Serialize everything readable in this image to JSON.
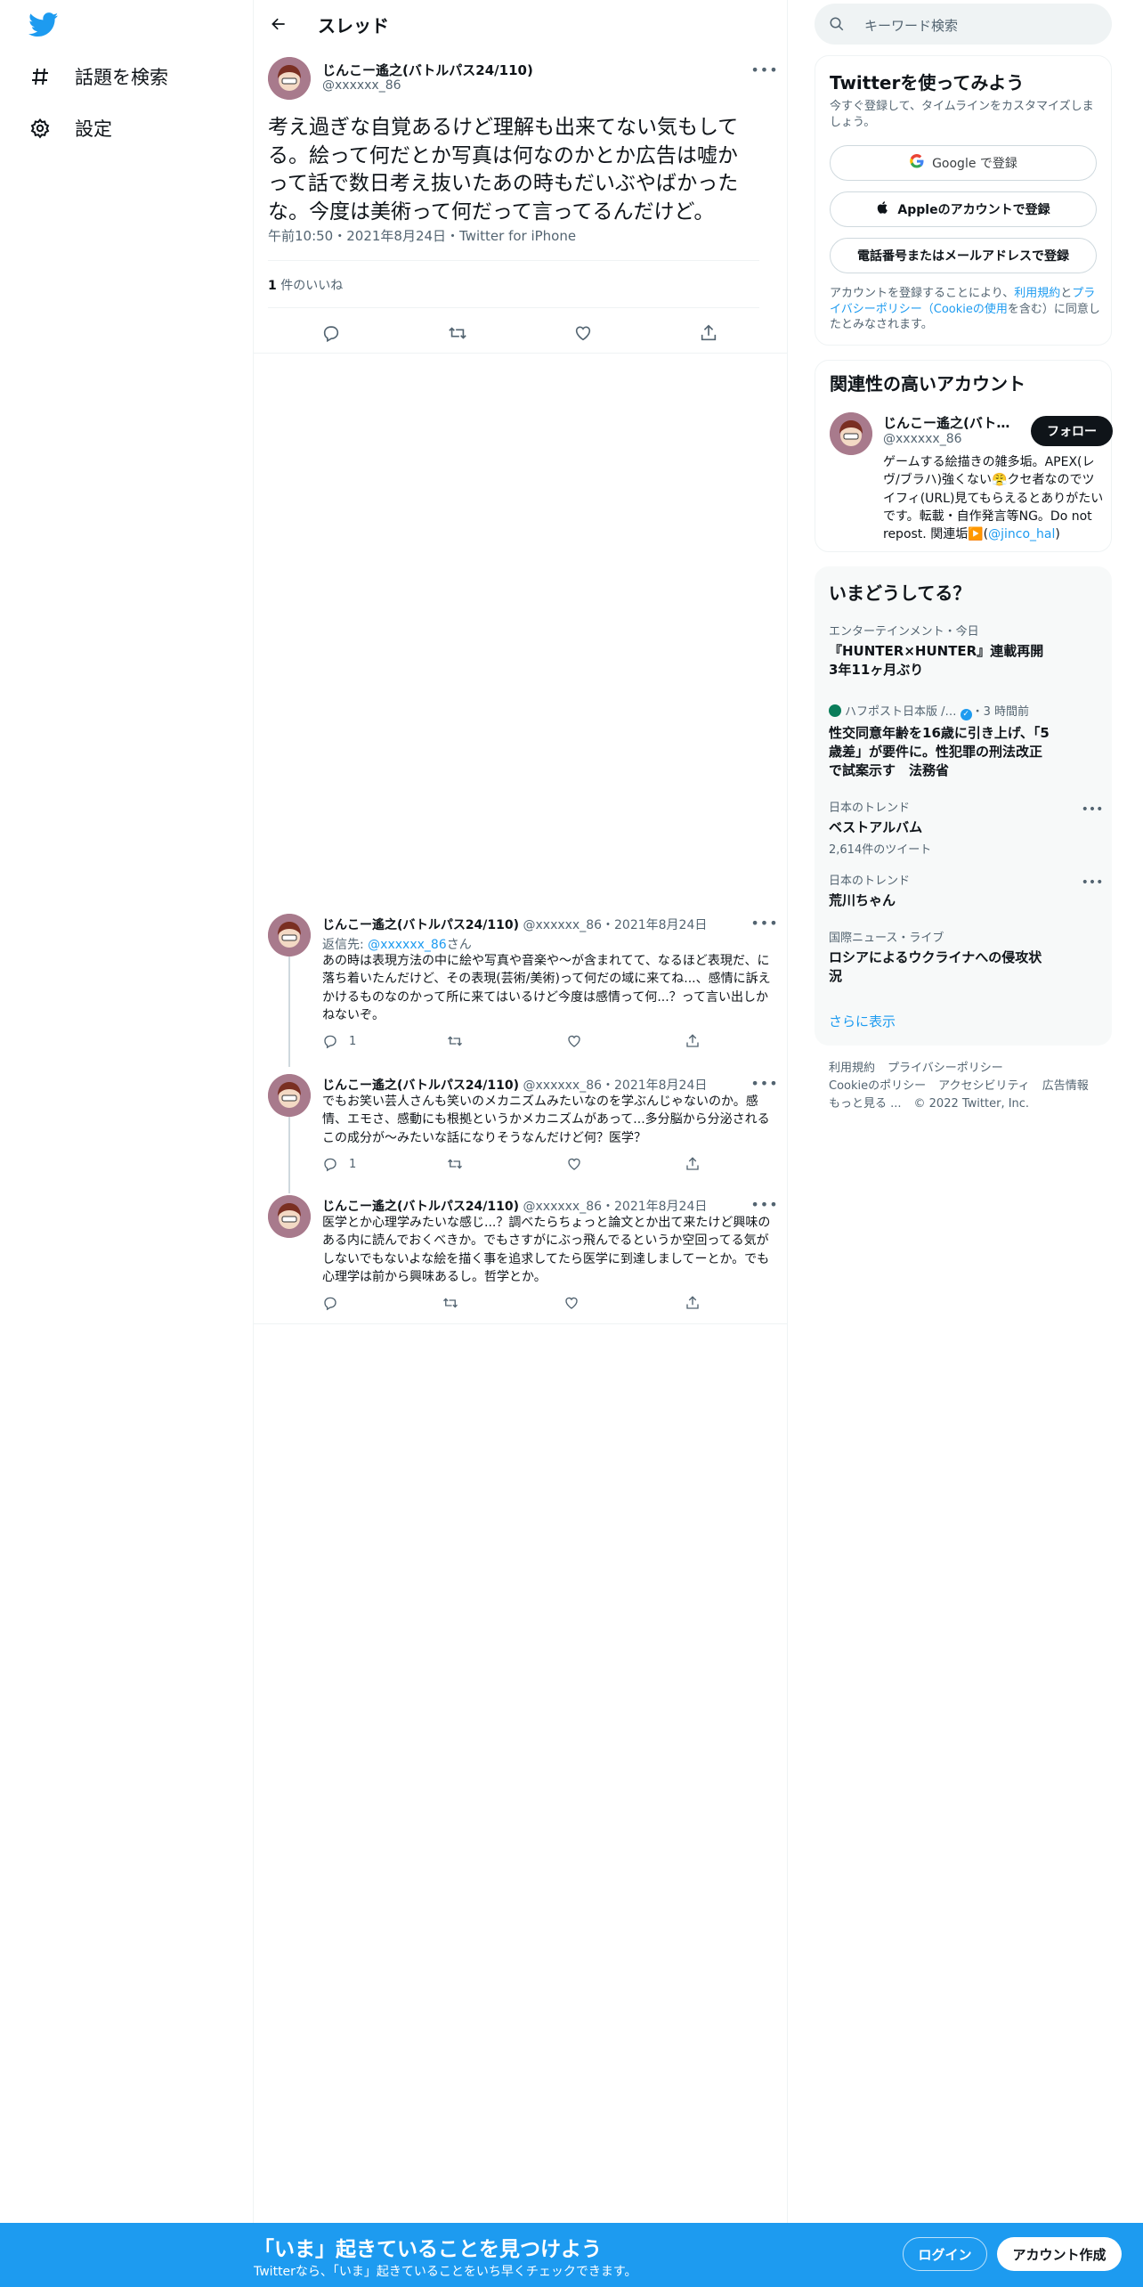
{
  "nav": {
    "logo_icon": "twitter-bird-icon",
    "items": [
      {
        "label": "話題を検索",
        "icon": "hashtag-icon"
      },
      {
        "label": "設定",
        "icon": "gear-icon"
      }
    ]
  },
  "header": {
    "title": "スレッド",
    "back_icon": "arrow-left-icon"
  },
  "main_tweet": {
    "name": "じんこー遙之(バトルパス24/110)",
    "handle": "@xxxxxx_86",
    "text": "考え過ぎな自覚あるけど理解も出来てない気もしてる。絵って何だとか写真は何なのかとか広告は嘘かって話で数日考え抜いたあの時もだいぶやばかったな。今度は美術って何だって言ってるんだけど。",
    "meta": "午前10:50・2021年8月24日・Twitter for iPhone",
    "likes_count": "1",
    "likes_label": "件のいいね"
  },
  "replies": [
    {
      "name": "じんこー遙之(バトルパス24/110)",
      "handle_date": "@xxxxxx_86・2021年8月24日",
      "reply_to_prefix": "返信先: ",
      "reply_to_mention": "@xxxxxx_86",
      "reply_to_suffix": "さん",
      "text": "あの時は表現方法の中に絵や写真や音楽や〜が含まれてて、なるほど表現だ、に落ち着いたんだけど、その表現(芸術/美術)って何だの域に来てね...、感情に訴えかけるものなのかって所に来てはいるけど今度は感情って何...？って言い出しかねないぞ。",
      "reply_count": "1"
    },
    {
      "name": "じんこー遙之(バトルパス24/110)",
      "handle_date": "@xxxxxx_86・2021年8月24日",
      "text": "でもお笑い芸人さんも笑いのメカニズムみたいなのを学ぶんじゃないのか。感情、エモさ、感動にも根拠というかメカニズムがあって...多分脳から分泌されるこの成分が〜みたいな話になりそうなんだけど何？医学？",
      "reply_count": "1"
    },
    {
      "name": "じんこー遙之(バトルパス24/110)",
      "handle_date": "@xxxxxx_86・2021年8月24日",
      "text": "医学とか心理学みたいな感じ...？調べたらちょっと論文とか出て来たけど興味のある内に読んでおくべきか。でもさすがにぶっ飛んでるというか空回ってる気がしないでもないよな絵を描く事を追求してたら医学に到達しましてーとか。でも心理学は前から興味あるし。哲学とか。"
    }
  ],
  "search": {
    "placeholder": "キーワード検索"
  },
  "signup": {
    "title": "Twitterを使ってみよう",
    "subtitle": "今すぐ登録して、タイムラインをカスタマイズしましょう。",
    "google_label": "Google で登録",
    "apple_label": "Appleのアカウントで登録",
    "phone_label": "電話番号またはメールアドレスで登録",
    "terms_prefix": "アカウントを登録することにより、",
    "terms_link1": "利用規約",
    "terms_mid1": "と",
    "terms_link2": "プライバシーポリシー（Cookieの使用",
    "terms_suffix": "を含む）に同意したとみなされます。"
  },
  "related": {
    "title": "関連性の高いアカウント",
    "name": "じんこー遙之(バトルパス24/110)",
    "handle": "@xxxxxx_86",
    "follow_label": "フォロー",
    "bio": "ゲームする絵描きの雑多垢。APEX(レヴ/ブラハ)強くない😤クセ者なのでツイフィ(URL)見てもらえるとありがたいです。転載・自作発言等NG。Do not repost. 関連垢▶️(",
    "bio_link": "@jinco_hal",
    "bio_end": ")"
  },
  "trends": {
    "title": "いまどうしてる？",
    "items": [
      {
        "context": "エンターテインメント・今日",
        "title": "『HUNTER×HUNTER』連載再開 3年11ヶ月ぶり"
      },
      {
        "context": "ハフポスト日本版 /…",
        "context_time": "・3 時間前",
        "title": "性交同意年齢を16歳に引き上げ、「5歳差」が要件に。性犯罪の刑法改正で試案示す　法務省"
      },
      {
        "context": "日本のトレンド",
        "title": "ベストアルバム",
        "count": "2,614件のツイート"
      },
      {
        "context": "日本のトレンド",
        "title": "荒川ちゃん"
      },
      {
        "context": "国際ニュース・ライブ",
        "title": "ロシアによるウクライナへの侵攻状況"
      }
    ],
    "show_more": "さらに表示"
  },
  "footer": {
    "links": [
      "利用規約",
      "プライバシーポリシー",
      "Cookieのポリシー",
      "アクセシビリティ",
      "広告情報",
      "もっと見る ..."
    ],
    "copyright": "© 2022 Twitter, Inc."
  },
  "bottom_bar": {
    "title": "「いま」起きていることを見つけよう",
    "subtitle": "Twitterなら、「いま」起きていることをいち早くチェックできます。",
    "login_label": "ログイン",
    "signup_label": "アカウント作成"
  },
  "colors": {
    "accent": "#1d9bf0",
    "text": "#0f1419",
    "muted": "#536471",
    "follow_btn": "#0f1419"
  }
}
